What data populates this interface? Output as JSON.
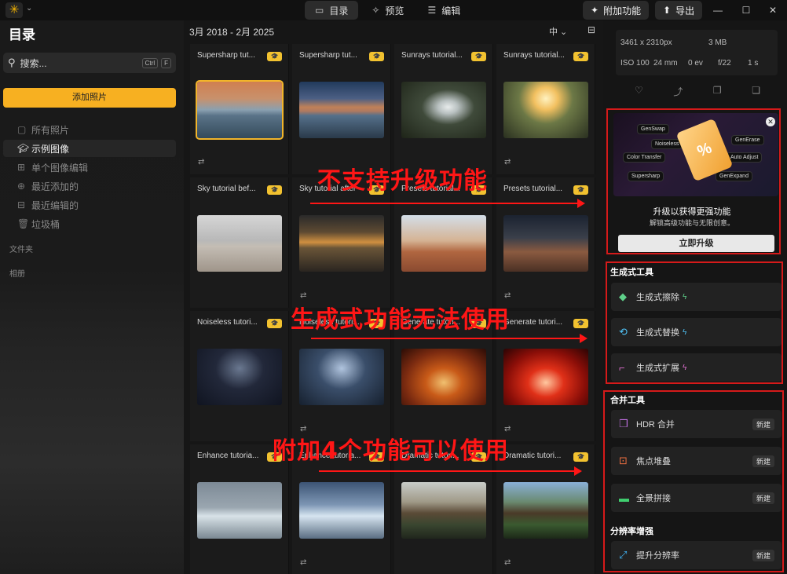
{
  "topbar": {
    "tabs": [
      {
        "label": "目录",
        "icon": "folder-icon"
      },
      {
        "label": "预览",
        "icon": "sparkle-wand-icon"
      },
      {
        "label": "编辑",
        "icon": "sliders-icon"
      }
    ],
    "addons_label": "附加功能",
    "export_label": "导出",
    "window": {
      "minimize": "—",
      "maximize": "☐",
      "close": "✕"
    }
  },
  "sidebar": {
    "title": "目录",
    "search_placeholder": "搜索...",
    "search_kbd": [
      "Ctrl",
      "F"
    ],
    "add_photo_label": "添加照片",
    "items": [
      {
        "label": "所有照片",
        "icon": "photos-icon"
      },
      {
        "label": "示例图像",
        "icon": "graduation-cap-icon"
      },
      {
        "label": "单个图像编辑",
        "icon": "grid-icon"
      },
      {
        "label": "最近添加的",
        "icon": "recent-add-icon"
      },
      {
        "label": "最近编辑的",
        "icon": "recent-edit-icon"
      },
      {
        "label": "垃圾桶",
        "icon": "trash-icon"
      }
    ],
    "folders_label": "文件夹",
    "albums_label": "相册"
  },
  "main": {
    "date_range": "3月 2018 - 2月 2025",
    "zoom_label": "中 ⌄",
    "tiles": [
      {
        "title": "Supersharp tut...",
        "thumb": "t-ice-sunset",
        "selected": true,
        "adjusted": true
      },
      {
        "title": "Supersharp tut...",
        "thumb": "t-ice-sunset2",
        "adjusted": false
      },
      {
        "title": "Sunrays tutorial...",
        "thumb": "t-waterfall",
        "adjusted": false
      },
      {
        "title": "Sunrays tutorial...",
        "thumb": "t-waterfall2",
        "adjusted": true
      },
      {
        "title": "Sky tutorial bef...",
        "thumb": "t-beach",
        "adjusted": false
      },
      {
        "title": "Sky tutorial after",
        "thumb": "t-beach-dark",
        "adjusted": true
      },
      {
        "title": "Presets tutorial...",
        "thumb": "t-arch",
        "adjusted": false
      },
      {
        "title": "Presets tutorial...",
        "thumb": "t-arch-night",
        "adjusted": true
      },
      {
        "title": "Noiseless tutori...",
        "thumb": "t-cave",
        "adjusted": false
      },
      {
        "title": "Noiseless tutori...",
        "thumb": "t-cave2",
        "adjusted": true
      },
      {
        "title": "Generate tutori...",
        "thumb": "t-torii",
        "adjusted": false
      },
      {
        "title": "Generate tutori...",
        "thumb": "t-torii2",
        "adjusted": true
      },
      {
        "title": "Enhance tutoria...",
        "thumb": "t-glacier",
        "adjusted": false
      },
      {
        "title": "Enhance tutoria...",
        "thumb": "t-glacier2",
        "adjusted": true
      },
      {
        "title": "Dramatic tutori...",
        "thumb": "t-mountain",
        "adjusted": false
      },
      {
        "title": "Dramatic tutori...",
        "thumb": "t-mountain2",
        "adjusted": true
      }
    ],
    "badge_icon": "🎓",
    "adjust_icon": "⇄"
  },
  "info": {
    "dimensions": "3461 x 2310px",
    "size": "3 MB",
    "iso": "ISO 100",
    "focal": "24 mm",
    "ev": "0 ev",
    "aperture": "f/22",
    "shutter": "1 s",
    "icons": [
      "heart-icon",
      "rotate-icon",
      "copy-icon",
      "stack-icon"
    ]
  },
  "promo": {
    "chips": [
      "GenSwap",
      "Noiseless",
      "GenErase",
      "Color Transfer",
      "Auto Adjust",
      "Supersharp",
      "GenExpand"
    ],
    "ticket": "%",
    "title": "升级以获得更强功能",
    "subtitle": "解锁高级功能与无限创意。",
    "button": "立即升级"
  },
  "generative": {
    "title": "生成式工具",
    "tools": [
      {
        "label": "生成式擦除",
        "icon": "eraser-icon",
        "color": "#5fd08a"
      },
      {
        "label": "生成式替换",
        "icon": "swap-icon",
        "color": "#4fc3f7"
      },
      {
        "label": "生成式扩展",
        "icon": "expand-icon",
        "color": "#e070d0"
      }
    ]
  },
  "merge": {
    "title": "合并工具",
    "tools": [
      {
        "label": "HDR 合并",
        "icon": "hdr-icon",
        "color": "#c070e0",
        "badge": "新建"
      },
      {
        "label": "焦点堆叠",
        "icon": "focus-icon",
        "color": "#f07040",
        "badge": "新建"
      },
      {
        "label": "全景拼接",
        "icon": "panorama-icon",
        "color": "#40d070",
        "badge": "新建"
      }
    ]
  },
  "resolution": {
    "title": "分辨率增强",
    "tools": [
      {
        "label": "提升分辨率",
        "icon": "upscale-icon",
        "color": "#40b0f0",
        "badge": "新建"
      }
    ]
  },
  "annotations": {
    "row1": "不支持升级功能",
    "row2": "生成式功能无法使用",
    "row3": "附加4个功能可以使用"
  }
}
